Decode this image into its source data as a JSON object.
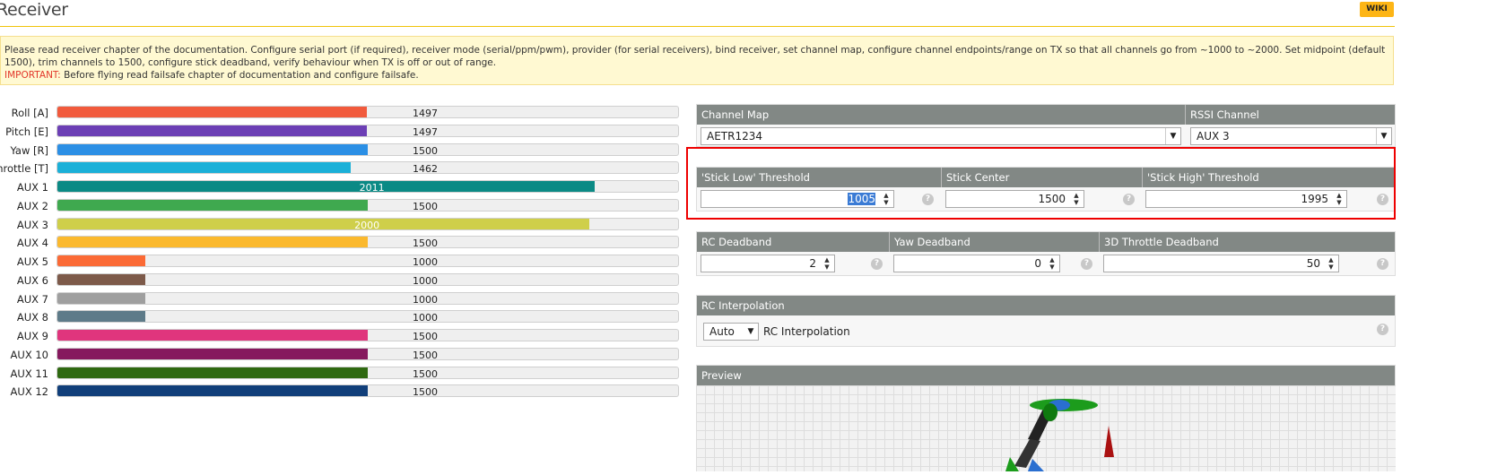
{
  "header": {
    "title": "Receiver",
    "wiki_label": "WIKI"
  },
  "notice": {
    "text": "Please read receiver chapter of the documentation. Configure serial port (if required), receiver mode (serial/ppm/pwm), provider (for serial receivers), bind receiver, set channel map, configure channel endpoints/range on TX so that all channels go from ~1000 to ~2000. Set midpoint (default 1500), trim channels to 1500, configure stick deadband, verify behaviour when TX is off or out of range.",
    "important_label": "IMPORTANT:",
    "important_text": "Before flying read failsafe chapter of documentation and configure failsafe."
  },
  "channels": [
    {
      "label": "Roll [A]",
      "value": "1497",
      "level": 1497,
      "color": "#f15a3c"
    },
    {
      "label": "Pitch [E]",
      "value": "1497",
      "level": 1497,
      "color": "#6c3fb5"
    },
    {
      "label": "Yaw [R]",
      "value": "1500",
      "level": 1500,
      "color": "#2b8fe5"
    },
    {
      "label": "Throttle [T]",
      "value": "1462",
      "level": 1462,
      "color": "#1bb0d8"
    },
    {
      "label": "AUX 1",
      "value": "2011",
      "level": 2011,
      "color": "#0b8a85"
    },
    {
      "label": "AUX 2",
      "value": "1500",
      "level": 1500,
      "color": "#3fa94f"
    },
    {
      "label": "AUX 3",
      "value": "2000",
      "level": 2000,
      "color": "#cfcf4a"
    },
    {
      "label": "AUX 4",
      "value": "1500",
      "level": 1500,
      "color": "#fbb92e"
    },
    {
      "label": "AUX 5",
      "value": "1000",
      "level": 1000,
      "color": "#fb6a35"
    },
    {
      "label": "AUX 6",
      "value": "1000",
      "level": 1000,
      "color": "#7d5a4a"
    },
    {
      "label": "AUX 7",
      "value": "1000",
      "level": 1000,
      "color": "#9f9f9f"
    },
    {
      "label": "AUX 8",
      "value": "1000",
      "level": 1000,
      "color": "#5e7b89"
    },
    {
      "label": "AUX 9",
      "value": "1500",
      "level": 1500,
      "color": "#e0357d"
    },
    {
      "label": "AUX 10",
      "value": "1500",
      "level": 1500,
      "color": "#86195e"
    },
    {
      "label": "AUX 11",
      "value": "1500",
      "level": 1500,
      "color": "#2f6911"
    },
    {
      "label": "AUX 12",
      "value": "1500",
      "level": 1500,
      "color": "#113f7a"
    }
  ],
  "channel_map": {
    "header": "Channel Map",
    "value": "AETR1234"
  },
  "rssi": {
    "header": "RSSI Channel",
    "value": "AUX 3"
  },
  "thresholds": {
    "low_header": "'Stick Low' Threshold",
    "low_value": "1005",
    "center_header": "Stick Center",
    "center_value": "1500",
    "high_header": "'Stick High' Threshold",
    "high_value": "1995"
  },
  "deadband": {
    "rc_header": "RC Deadband",
    "rc_value": "2",
    "yaw_header": "Yaw Deadband",
    "yaw_value": "0",
    "throttle3d_header": "3D Throttle Deadband",
    "throttle3d_value": "50"
  },
  "interpolation": {
    "header": "RC Interpolation",
    "value": "Auto",
    "label": "RC Interpolation"
  },
  "preview": {
    "header": "Preview"
  },
  "help_glyph": "?"
}
